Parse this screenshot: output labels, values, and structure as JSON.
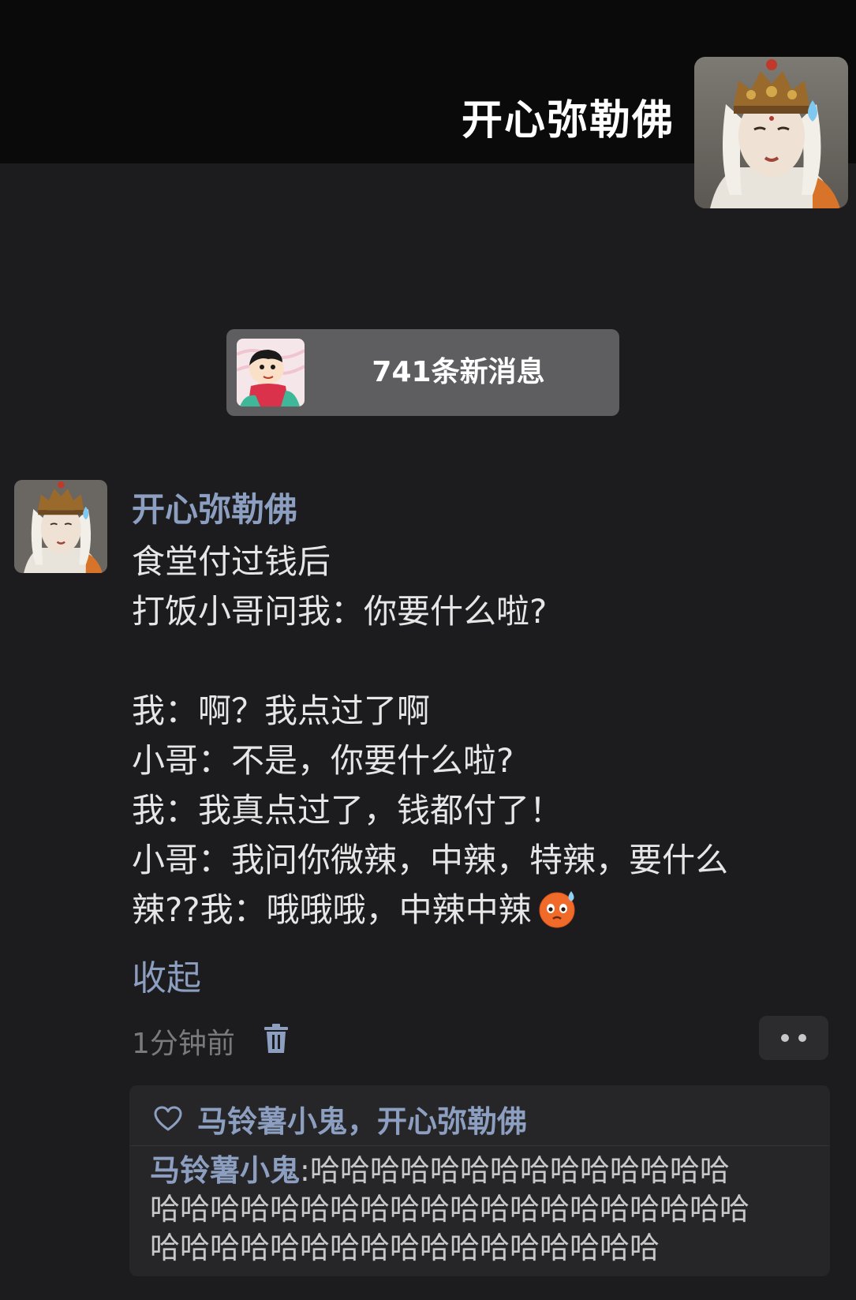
{
  "header": {
    "title": "开心弥勒佛",
    "avatar_icon": "bodhisattva-statue-avatar"
  },
  "new_messages": {
    "label": "741条新消息",
    "avatar_icon": "cartoon-boy-avatar"
  },
  "post": {
    "author": "开心弥勒佛",
    "avatar_icon": "bodhisattva-statue-avatar",
    "lines": [
      "食堂付过钱后",
      "打饭小哥问我：你要什么啦?",
      "",
      "我：啊？我点过了啊",
      "小哥：不是，你要什么啦?",
      "我：我真点过了，钱都付了！",
      "小哥：我问你微辣，中辣，特辣，要什么",
      "辣??我：哦哦哦，中辣中辣"
    ],
    "emoji_icon": "sweating-face-emoji",
    "collapse_label": "收起",
    "time": "1分钟前",
    "delete_icon": "trash-icon",
    "more_icon": "more-dots-icon"
  },
  "comments": {
    "like_icon": "heart-icon",
    "likes": "马铃薯小鬼，开心弥勒佛",
    "items": [
      {
        "author": "马铃薯小鬼",
        "separator": ":",
        "line1": "哈哈哈哈哈哈哈哈哈哈哈哈哈哈",
        "line2": "哈哈哈哈哈哈哈哈哈哈哈哈哈哈哈哈哈哈哈哈",
        "line3": "哈哈哈哈哈哈哈哈哈哈哈哈哈哈哈哈哈"
      }
    ]
  },
  "colors": {
    "background": "#1c1c1e",
    "header_background": "#0a0a0a",
    "accent_name": "#8d9fc1",
    "pill_background": "#5e5e60",
    "comment_background": "#262628"
  }
}
